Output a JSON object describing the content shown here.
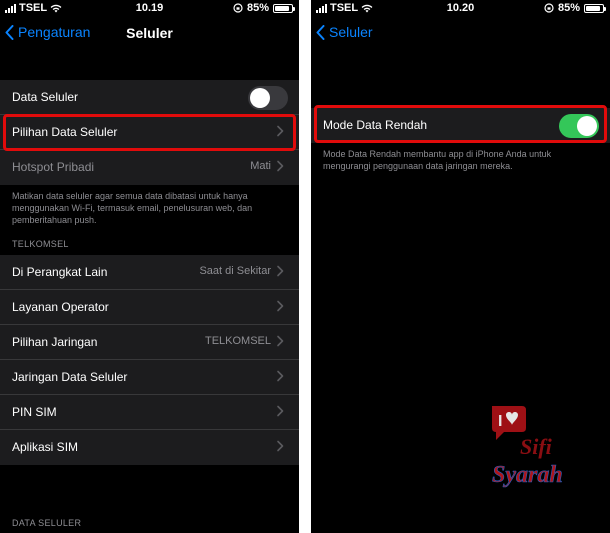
{
  "left": {
    "status": {
      "carrier": "TSEL",
      "time": "10.19",
      "battery": "85%"
    },
    "nav": {
      "back": "Pengaturan",
      "title": "Seluler"
    },
    "rows_top": [
      {
        "label": "Data Seluler",
        "toggle": "off"
      },
      {
        "label": "Pilihan Data Seluler"
      },
      {
        "label": "Hotspot Pribadi",
        "value": "Mati"
      }
    ],
    "footer": "Matikan data seluler agar semua data dibatasi untuk hanya menggunakan Wi-Fi, termasuk email, penelusuran web, dan pemberitahuan push.",
    "section_header": "TELKOMSEL",
    "rows_carrier": [
      {
        "label": "Di Perangkat Lain",
        "value": "Saat di Sekitar"
      },
      {
        "label": "Layanan Operator",
        "value": ""
      },
      {
        "label": "Pilihan Jaringan",
        "value": "TELKOMSEL"
      },
      {
        "label": "Jaringan Data Seluler",
        "value": ""
      },
      {
        "label": "PIN SIM",
        "value": ""
      },
      {
        "label": "Aplikasi SIM",
        "value": ""
      }
    ],
    "section_header2": "DATA SELULER"
  },
  "right": {
    "status": {
      "carrier": "TSEL",
      "time": "10.20",
      "battery": "85%"
    },
    "nav": {
      "back": "Seluler"
    },
    "row": {
      "label": "Mode Data Rendah",
      "toggle": "on"
    },
    "footer": "Mode Data Rendah membantu app di iPhone Anda untuk mengurangi penggunaan data jaringan mereka."
  },
  "watermark": {
    "line1": "Sifi",
    "line2": "Syarah"
  },
  "colors": {
    "accent": "#0a84ff",
    "toggle_on": "#34c759",
    "highlight": "#e10b0b"
  }
}
